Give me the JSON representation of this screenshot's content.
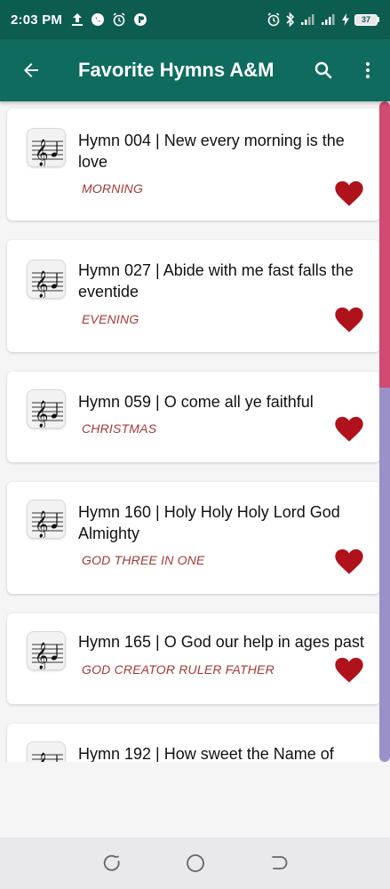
{
  "status_bar": {
    "time": "2:03 PM",
    "battery_level": "37",
    "left_icons": [
      "upload-icon",
      "whatsapp-icon",
      "alarm-icon",
      "app-icon"
    ],
    "right_icons": [
      "alarm-icon",
      "bluetooth-icon",
      "signal-icon",
      "signal-icon",
      "charging-icon"
    ]
  },
  "app_bar": {
    "title": "Favorite Hymns A&M",
    "back_icon": "arrow-left-icon",
    "search_icon": "search-icon",
    "menu_icon": "more-vert-icon",
    "color": "#0e6b5d"
  },
  "hymns": [
    {
      "title": "Hymn 004 | New every morning is the love",
      "category": "MORNING",
      "favorite": true
    },
    {
      "title": "Hymn 027 |  Abide with me fast falls the eventide",
      "category": "EVENING",
      "favorite": true
    },
    {
      "title": "Hymn 059 |  O come all ye faithful",
      "category": "CHRISTMAS",
      "favorite": true
    },
    {
      "title": "Hymn 160 | Holy Holy Holy Lord God Almighty",
      "category": "GOD THREE IN ONE",
      "favorite": true
    },
    {
      "title": "Hymn 165 | O God our help in ages past",
      "category": "GOD CREATOR RULER FATHER",
      "favorite": true
    },
    {
      "title": "Hymn 192 | How sweet the Name of",
      "category": "",
      "favorite": true
    }
  ],
  "colors": {
    "category_text": "#a33a33",
    "heart": "#b0121b",
    "scrollbar_top": "#d04a72",
    "scrollbar_rest": "#9b91c9"
  },
  "nav_bar": {
    "buttons": [
      "recents-icon",
      "home-icon",
      "back-icon"
    ]
  }
}
